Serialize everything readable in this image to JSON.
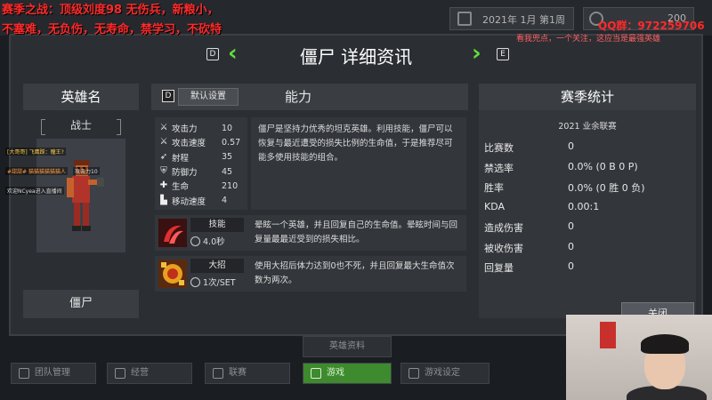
{
  "overlay": {
    "line1": "赛季之战：顶级刘度98 无伤兵，新粮小，",
    "line2": "不塞难，无负伤，无寿命，禁学习，不砍特",
    "qq": "QQ群：972259706",
    "qq_sub": "看我兜点，一个关注，这应当是最强英雄"
  },
  "top_bar": {
    "date": "2021年 1月 第1周",
    "coins": "200"
  },
  "header": {
    "title": "僵尸 详细资讯",
    "prev_key": "D",
    "next_key": "E",
    "prev_icon": "chevron-left-icon",
    "next_icon": "chevron-right-icon"
  },
  "hero": {
    "section_title": "英雄名",
    "class": "战士",
    "name": "僵尸",
    "chat": [
      "[大哥哥] 飞鹰踩：瞳王?",
      "#甜甜# 猫猫猫猫猫猫人",
      "欢迎NCyea进入直播间",
      "攻击力10"
    ]
  },
  "ability": {
    "default_key": "D",
    "default_btn": "默认设置",
    "title": "能力",
    "stats": [
      {
        "icon": "sword-icon",
        "label": "攻击力",
        "value": "10"
      },
      {
        "icon": "attack-speed-icon",
        "label": "攻击速度",
        "value": "0.57"
      },
      {
        "icon": "range-icon",
        "label": "射程",
        "value": "35"
      },
      {
        "icon": "shield-icon",
        "label": "防御力",
        "value": "45"
      },
      {
        "icon": "health-icon",
        "label": "生命",
        "value": "210"
      },
      {
        "icon": "boot-icon",
        "label": "移动速度",
        "value": "4"
      }
    ],
    "description": "僵尸是坚持力优秀的坦克英雄。利用技能，僵尸可以恢复与最近遭受的损失比例的生命值，于是推荐尽可能多使用技能的组合。",
    "skill": {
      "name": "技能",
      "cooldown": "4.0秒",
      "description": "晕眩一个英雄，并且回复自己的生命值。晕眩时间与回复量最最近受到的损失相比。"
    },
    "ultimate": {
      "name": "大招",
      "cooldown": "1次/SET",
      "description": "使用大招后体力达到0也不死，并且回复最大生命值次数为两次。"
    }
  },
  "season": {
    "title": "赛季统计",
    "subtitle": "2021 业余联赛",
    "rows": [
      {
        "label": "比赛数",
        "value": "0"
      },
      {
        "label": "禁选率",
        "value": "0.0% (0 B 0 P)"
      },
      {
        "label": "胜率",
        "value": "0.0% (0 胜 0 负)"
      },
      {
        "label": "KDA",
        "value": "0.00:1"
      },
      {
        "label": "造成伤害",
        "value": "0"
      },
      {
        "label": "被收伤害",
        "value": "0"
      },
      {
        "label": "回复量",
        "value": "0"
      }
    ]
  },
  "close_btn": "关闭",
  "bottom": {
    "hero_info": "英雄资料",
    "buttons": [
      {
        "label": "团队管理",
        "icon": "team-icon"
      },
      {
        "label": "经营",
        "icon": "business-icon"
      },
      {
        "label": "联赛",
        "icon": "league-icon"
      },
      {
        "label": "游戏",
        "icon": "gamepad-icon"
      },
      {
        "label": "游戏设定",
        "icon": "settings-icon"
      }
    ]
  }
}
